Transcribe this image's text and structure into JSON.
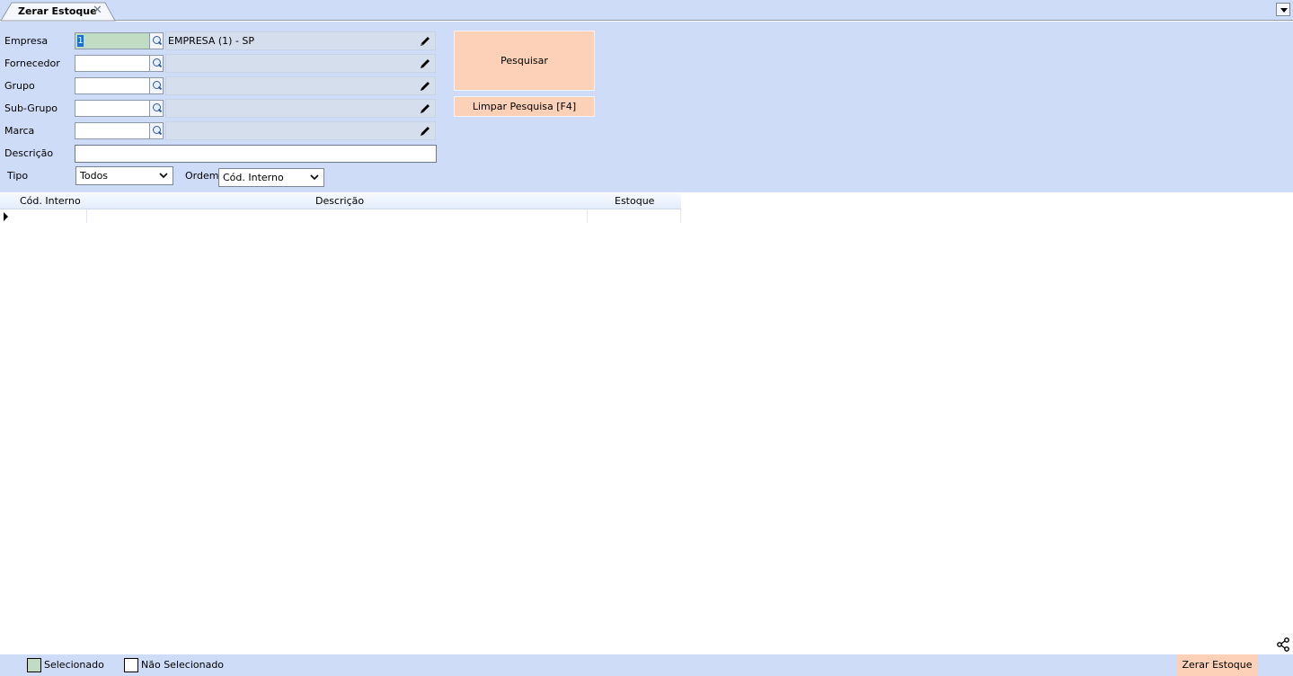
{
  "tab": {
    "title": "Zerar Estoque",
    "close_glyph": "✕",
    "menu_icon": "chevron-down-icon"
  },
  "form": {
    "empresa": {
      "label": "Empresa",
      "code": "1",
      "description": "EMPRESA (1) - SP"
    },
    "fornecedor": {
      "label": "Fornecedor",
      "code": "",
      "description": ""
    },
    "grupo": {
      "label": "Grupo",
      "code": "",
      "description": ""
    },
    "subgrupo": {
      "label": "Sub-Grupo",
      "code": "",
      "description": ""
    },
    "marca": {
      "label": "Marca",
      "code": "",
      "description": ""
    },
    "descricao": {
      "label": "Descrição",
      "value": ""
    },
    "tipo": {
      "label": "Tipo",
      "selected": "Todos"
    },
    "ordem": {
      "label": "Ordem",
      "selected": "Cód. Interno"
    }
  },
  "buttons": {
    "search": "Pesquisar",
    "clear": "Limpar Pesquisa [F4]",
    "zero_stock": "Zerar Estoque"
  },
  "grid": {
    "columns": [
      "Cód. Interno",
      "Descrição",
      "Estoque"
    ],
    "rows": []
  },
  "legend": {
    "selected": "Selecionado",
    "not_selected": "Não Selecionado"
  },
  "colors": {
    "panel_bg": "#cfdcf7",
    "accent_button": "#fcd1b8",
    "selected_green": "#c2dcc4",
    "selection_blue": "#1b6fcf"
  }
}
